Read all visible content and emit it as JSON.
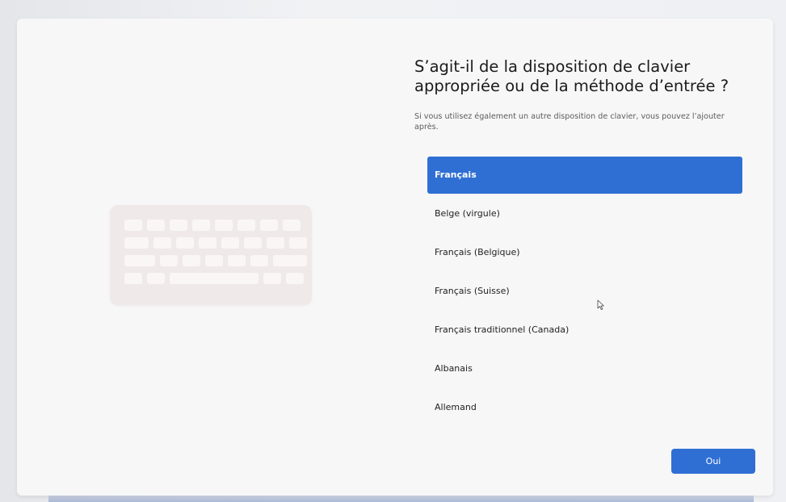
{
  "page": {
    "title": "S’agit-il de la disposition de clavier appropriée ou de la méthode d’entrée ?",
    "subtitle": "Si vous utilisez également un autre disposition de clavier, vous pouvez l’ajouter après."
  },
  "illustration": {
    "icon": "keyboard-icon"
  },
  "layouts": {
    "selected_index": 0,
    "items": [
      {
        "label": "Français"
      },
      {
        "label": "Belge (virgule)"
      },
      {
        "label": "Français (Belgique)"
      },
      {
        "label": "Français (Suisse)"
      },
      {
        "label": "Français traditionnel (Canada)"
      },
      {
        "label": "Albanais"
      },
      {
        "label": "Allemand"
      }
    ]
  },
  "actions": {
    "confirm_label": "Oui"
  },
  "colors": {
    "accent": "#2f6fd3",
    "window_bg": "#f7f7f8",
    "illustration_bg": "#f0e9ea"
  }
}
